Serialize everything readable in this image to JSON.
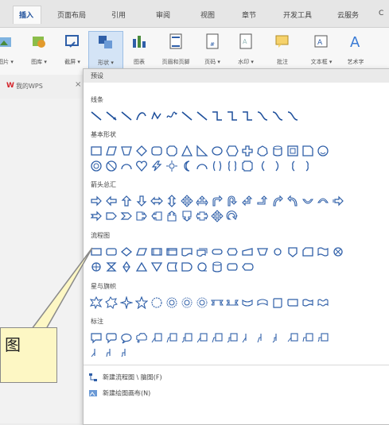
{
  "ribbon_tabs": [
    "插入",
    "页面布局",
    "引用",
    "审阅",
    "视图",
    "章节",
    "开发工具",
    "云服务",
    "C"
  ],
  "ribbon_buttons": [
    {
      "label": "图片 ▾",
      "icon": "picture-icon"
    },
    {
      "label": "图库 ▾",
      "icon": "gallery-icon"
    },
    {
      "label": "截屏 ▾",
      "icon": "screenshot-icon"
    },
    {
      "label": "形状 ▾",
      "icon": "shapes-icon"
    },
    {
      "label": "图表",
      "icon": "chart-icon"
    },
    {
      "label": "页眉和页脚",
      "icon": "header-footer-icon"
    },
    {
      "label": "页码 ▾",
      "icon": "page-number-icon"
    },
    {
      "label": "水印 ▾",
      "icon": "watermark-icon"
    },
    {
      "label": "批注",
      "icon": "comment-icon"
    },
    {
      "label": "文本框 ▾",
      "icon": "textbox-icon"
    },
    {
      "label": "艺术字",
      "icon": "wordart-icon"
    }
  ],
  "doc_tab": {
    "label": "我的WPS",
    "close": "×",
    "logo": "W"
  },
  "panel": {
    "preset": "预设",
    "sections": [
      "线条",
      "基本形状",
      "箭头总汇",
      "流程图",
      "星与旗帜",
      "标注"
    ],
    "footer": [
      "新建流程图 \\ 脑图(F)",
      "新建绘图画布(N)"
    ]
  },
  "callout": {
    "text": "图"
  },
  "colors": {
    "accent": "#1b4d9a",
    "selected": "#d4e4f6",
    "icon_blue": "#2f5fa8",
    "callout_bg": "#fdf7c4"
  }
}
